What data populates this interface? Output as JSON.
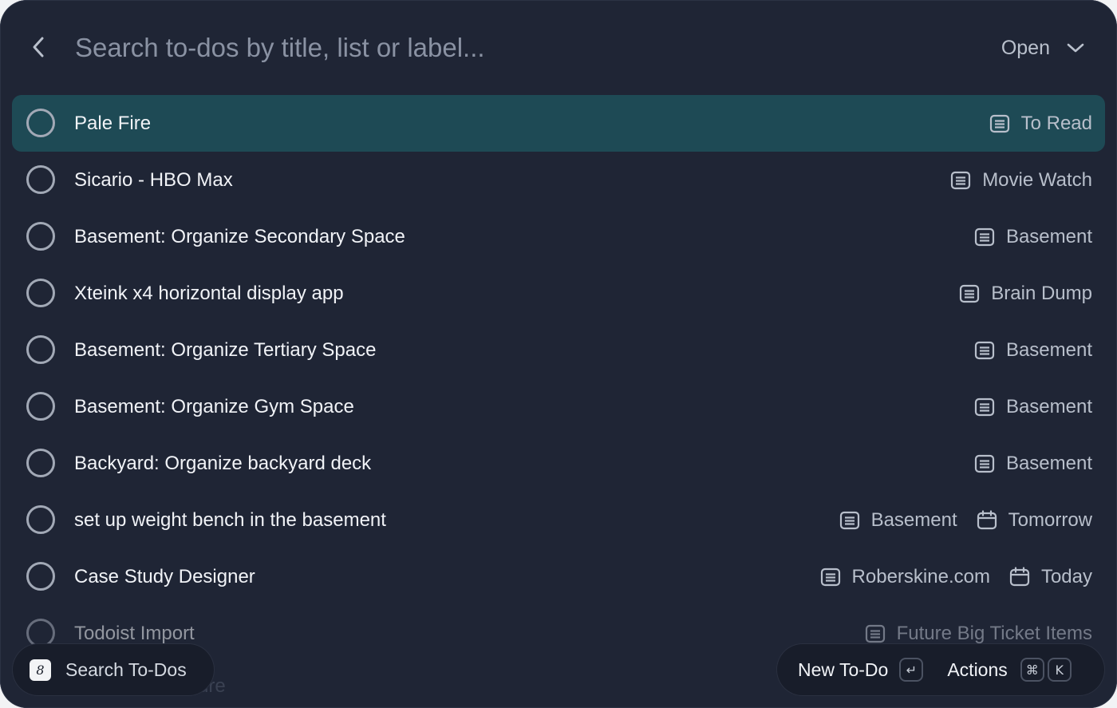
{
  "search": {
    "placeholder": "Search to-dos by title, list or label...",
    "filter_label": "Open"
  },
  "todos": [
    {
      "title": "Pale Fire",
      "list": "To Read",
      "date": ""
    },
    {
      "title": "Sicario - HBO Max",
      "list": "Movie Watch",
      "date": ""
    },
    {
      "title": "Basement: Organize Secondary Space",
      "list": "Basement",
      "date": ""
    },
    {
      "title": "Xteink x4 horizontal display app",
      "list": "Brain Dump",
      "date": ""
    },
    {
      "title": "Basement: Organize Tertiary Space",
      "list": "Basement",
      "date": ""
    },
    {
      "title": "Basement: Organize Gym Space",
      "list": "Basement",
      "date": ""
    },
    {
      "title": "Backyard: Organize backyard deck",
      "list": "Basement",
      "date": ""
    },
    {
      "title": "set up weight bench in the basement",
      "list": "Basement",
      "date": "Tomorrow"
    },
    {
      "title": "Case Study Designer",
      "list": "Roberskine.com",
      "date": "Today"
    },
    {
      "title": "Todoist Import",
      "list": "Future Big Ticket Items",
      "date": ""
    }
  ],
  "ghost_text": "ure",
  "footer": {
    "app_label": "Search To-Dos",
    "new_todo_label": "New To-Do",
    "actions_label": "Actions",
    "enter_key": "↵",
    "cmd_key": "⌘",
    "k_key": "K"
  }
}
